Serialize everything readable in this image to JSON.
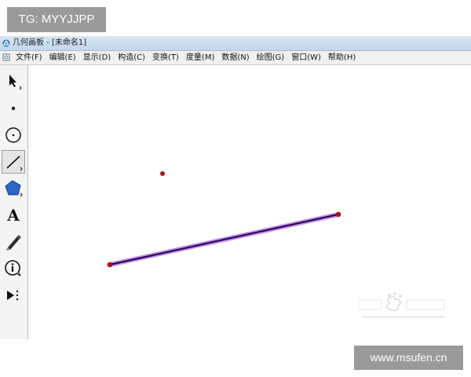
{
  "watermarks": {
    "top_left": "TG: MYYJJPP",
    "bottom_right": "www.msufen.cn"
  },
  "window": {
    "title": "几何画板 - [未命名1]"
  },
  "menu": {
    "items": [
      {
        "label": "文件(F)"
      },
      {
        "label": "编辑(E)"
      },
      {
        "label": "显示(D)"
      },
      {
        "label": "构造(C)"
      },
      {
        "label": "变换(T)"
      },
      {
        "label": "度量(M)"
      },
      {
        "label": "数据(N)"
      },
      {
        "label": "绘图(G)"
      },
      {
        "label": "窗口(W)"
      },
      {
        "label": "帮助(H)"
      }
    ]
  },
  "toolbox": {
    "tools": [
      {
        "name": "selection-arrow-tool",
        "icon": "arrow-icon"
      },
      {
        "name": "point-tool",
        "icon": "point-icon"
      },
      {
        "name": "compass-tool",
        "icon": "circle-icon"
      },
      {
        "name": "straightedge-tool",
        "icon": "segment-icon",
        "active": true
      },
      {
        "name": "polygon-tool",
        "icon": "polygon-icon"
      },
      {
        "name": "text-tool",
        "icon": "text-icon",
        "glyph": "A"
      },
      {
        "name": "marker-tool",
        "icon": "pen-icon"
      },
      {
        "name": "information-tool",
        "icon": "info-icon"
      },
      {
        "name": "custom-tool",
        "icon": "play-icon"
      }
    ]
  },
  "canvas": {
    "objects": [
      "free-point",
      "segment",
      "segment-endpoint-left",
      "segment-endpoint-right"
    ]
  },
  "colors": {
    "point": "#a3141b",
    "segment_core": "#2a0a55",
    "segment_highlight": "#c28cf0",
    "watermark_bg": "#9a9a9a",
    "titlebar": "#c9dbef"
  }
}
